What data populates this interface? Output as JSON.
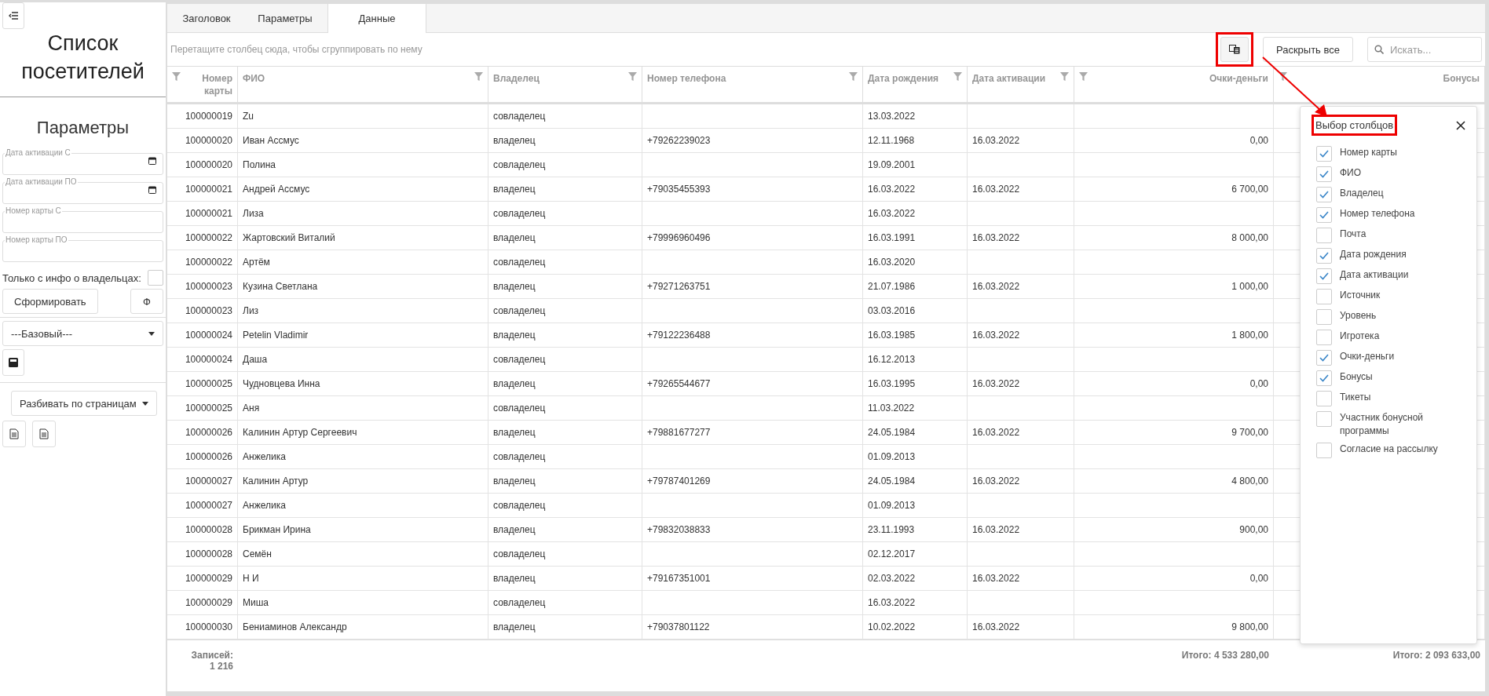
{
  "sidebar": {
    "title": "Список посетителей",
    "section": "Параметры",
    "fields": [
      {
        "label": "Дата активации С",
        "kind": "date"
      },
      {
        "label": "Дата активации ПО",
        "kind": "date"
      },
      {
        "label": "Номер карты С",
        "kind": "text"
      },
      {
        "label": "Номер карты ПО",
        "kind": "text"
      }
    ],
    "owners_only": {
      "label": "Только с инфо о владельцах:",
      "checked": false
    },
    "build_button": "Сформировать",
    "f_button": "Ф",
    "preset": "---Базовый---",
    "paging": "Разбивать по страницам"
  },
  "tabs": [
    {
      "label": "Заголовок",
      "selected": false
    },
    {
      "label": "Параметры",
      "selected": false
    },
    {
      "label": "Данные",
      "selected": true
    }
  ],
  "toolbar": {
    "group_hint": "Перетащите столбец сюда, чтобы сгруппировать по нему",
    "expand_button": "Раскрыть все",
    "search": {
      "placeholder": "Искать..."
    }
  },
  "table": {
    "columns": [
      {
        "label": "Номер карты",
        "kind": "number"
      },
      {
        "label": "ФИО",
        "kind": "text"
      },
      {
        "label": "Владелец",
        "kind": "text"
      },
      {
        "label": "Номер телефона",
        "kind": "text"
      },
      {
        "label": "Дата рождения",
        "kind": "text"
      },
      {
        "label": "Дата активации",
        "kind": "text"
      },
      {
        "label": "Очки-деньги",
        "kind": "number"
      },
      {
        "label": "Бонусы",
        "kind": "number"
      }
    ],
    "rows": [
      {
        "card": "100000019",
        "name": "Zu",
        "owner": "совладелец",
        "birth": "13.03.2022"
      },
      {
        "card": "100000020",
        "name": "Иван Ассмус",
        "owner": "владелец",
        "phone": "+79262239023",
        "birth": "12.11.1968",
        "activation": "16.03.2022",
        "points": "0,00"
      },
      {
        "card": "100000020",
        "name": "Полина",
        "owner": "совладелец",
        "birth": "19.09.2001"
      },
      {
        "card": "100000021",
        "name": "Андрей Ассмус",
        "owner": "владелец",
        "phone": "+79035455393",
        "birth": "16.03.2022",
        "activation": "16.03.2022",
        "points": "6 700,00"
      },
      {
        "card": "100000021",
        "name": "Лиза",
        "owner": "совладелец",
        "birth": "16.03.2022"
      },
      {
        "card": "100000022",
        "name": "Жартовский Виталий",
        "owner": "владелец",
        "phone": "+79996960496",
        "birth": "16.03.1991",
        "activation": "16.03.2022",
        "points": "8 000,00"
      },
      {
        "card": "100000022",
        "name": "Артём",
        "owner": "совладелец",
        "birth": "16.03.2020"
      },
      {
        "card": "100000023",
        "name": "Кузина Светлана",
        "owner": "владелец",
        "phone": "+79271263751",
        "birth": "21.07.1986",
        "activation": "16.03.2022",
        "points": "1 000,00"
      },
      {
        "card": "100000023",
        "name": "Лиз",
        "owner": "совладелец",
        "birth": "03.03.2016"
      },
      {
        "card": "100000024",
        "name": "Petelin Vladimir",
        "owner": "владелец",
        "phone": "+79122236488",
        "birth": "16.03.1985",
        "activation": "16.03.2022",
        "points": "1 800,00"
      },
      {
        "card": "100000024",
        "name": "Даша",
        "owner": "совладелец",
        "birth": "16.12.2013"
      },
      {
        "card": "100000025",
        "name": "Чудновцева Инна",
        "owner": "владелец",
        "phone": "+79265544677",
        "birth": "16.03.1995",
        "activation": "16.03.2022",
        "points": "0,00"
      },
      {
        "card": "100000025",
        "name": "Аня",
        "owner": "совладелец",
        "birth": "11.03.2022"
      },
      {
        "card": "100000026",
        "name": "Калинин Артур Сергеевич",
        "owner": "владелец",
        "phone": "+79881677277",
        "birth": "24.05.1984",
        "activation": "16.03.2022",
        "points": "9 700,00"
      },
      {
        "card": "100000026",
        "name": "Анжелика",
        "owner": "совладелец",
        "birth": "01.09.2013"
      },
      {
        "card": "100000027",
        "name": "Калинин Артур",
        "owner": "владелец",
        "phone": "+79787401269",
        "birth": "24.05.1984",
        "activation": "16.03.2022",
        "points": "4 800,00"
      },
      {
        "card": "100000027",
        "name": "Анжелика",
        "owner": "совладелец",
        "birth": "01.09.2013"
      },
      {
        "card": "100000028",
        "name": "Брикман Ирина",
        "owner": "владелец",
        "phone": "+79832038833",
        "birth": "23.11.1993",
        "activation": "16.03.2022",
        "points": "900,00"
      },
      {
        "card": "100000028",
        "name": "Семён",
        "owner": "совладелец",
        "birth": "02.12.2017"
      },
      {
        "card": "100000029",
        "name": "Н И",
        "owner": "владелец",
        "phone": "+79167351001",
        "birth": "02.03.2022",
        "activation": "16.03.2022",
        "points": "0,00"
      },
      {
        "card": "100000029",
        "name": "Миша",
        "owner": "совладелец",
        "birth": "16.03.2022"
      },
      {
        "card": "100000030",
        "name": "Бениаминов Александр",
        "owner": "владелец",
        "phone": "+79037801122",
        "birth": "10.02.2022",
        "activation": "16.03.2022",
        "points": "9 800,00"
      }
    ],
    "footer": {
      "records_label": "Записей:",
      "records_count": "1 216",
      "points_total": "Итого: 4 533 280,00",
      "bonus_total": "Итого: 2 093 633,00"
    }
  },
  "column_chooser": {
    "title": "Выбор столбцов",
    "items": [
      {
        "label": "Номер карты",
        "checked": true
      },
      {
        "label": "ФИО",
        "checked": true
      },
      {
        "label": "Владелец",
        "checked": true
      },
      {
        "label": "Номер телефона",
        "checked": true
      },
      {
        "label": "Почта",
        "checked": false
      },
      {
        "label": "Дата рождения",
        "checked": true
      },
      {
        "label": "Дата активации",
        "checked": true
      },
      {
        "label": "Источник",
        "checked": false
      },
      {
        "label": "Уровень",
        "checked": false
      },
      {
        "label": "Игротека",
        "checked": false
      },
      {
        "label": "Очки-деньги",
        "checked": true
      },
      {
        "label": "Бонусы",
        "checked": true
      },
      {
        "label": "Тикеты",
        "checked": false
      },
      {
        "label": "Участник бонусной программы",
        "checked": false
      },
      {
        "label": "Согласие на рассылку",
        "checked": false
      }
    ]
  }
}
